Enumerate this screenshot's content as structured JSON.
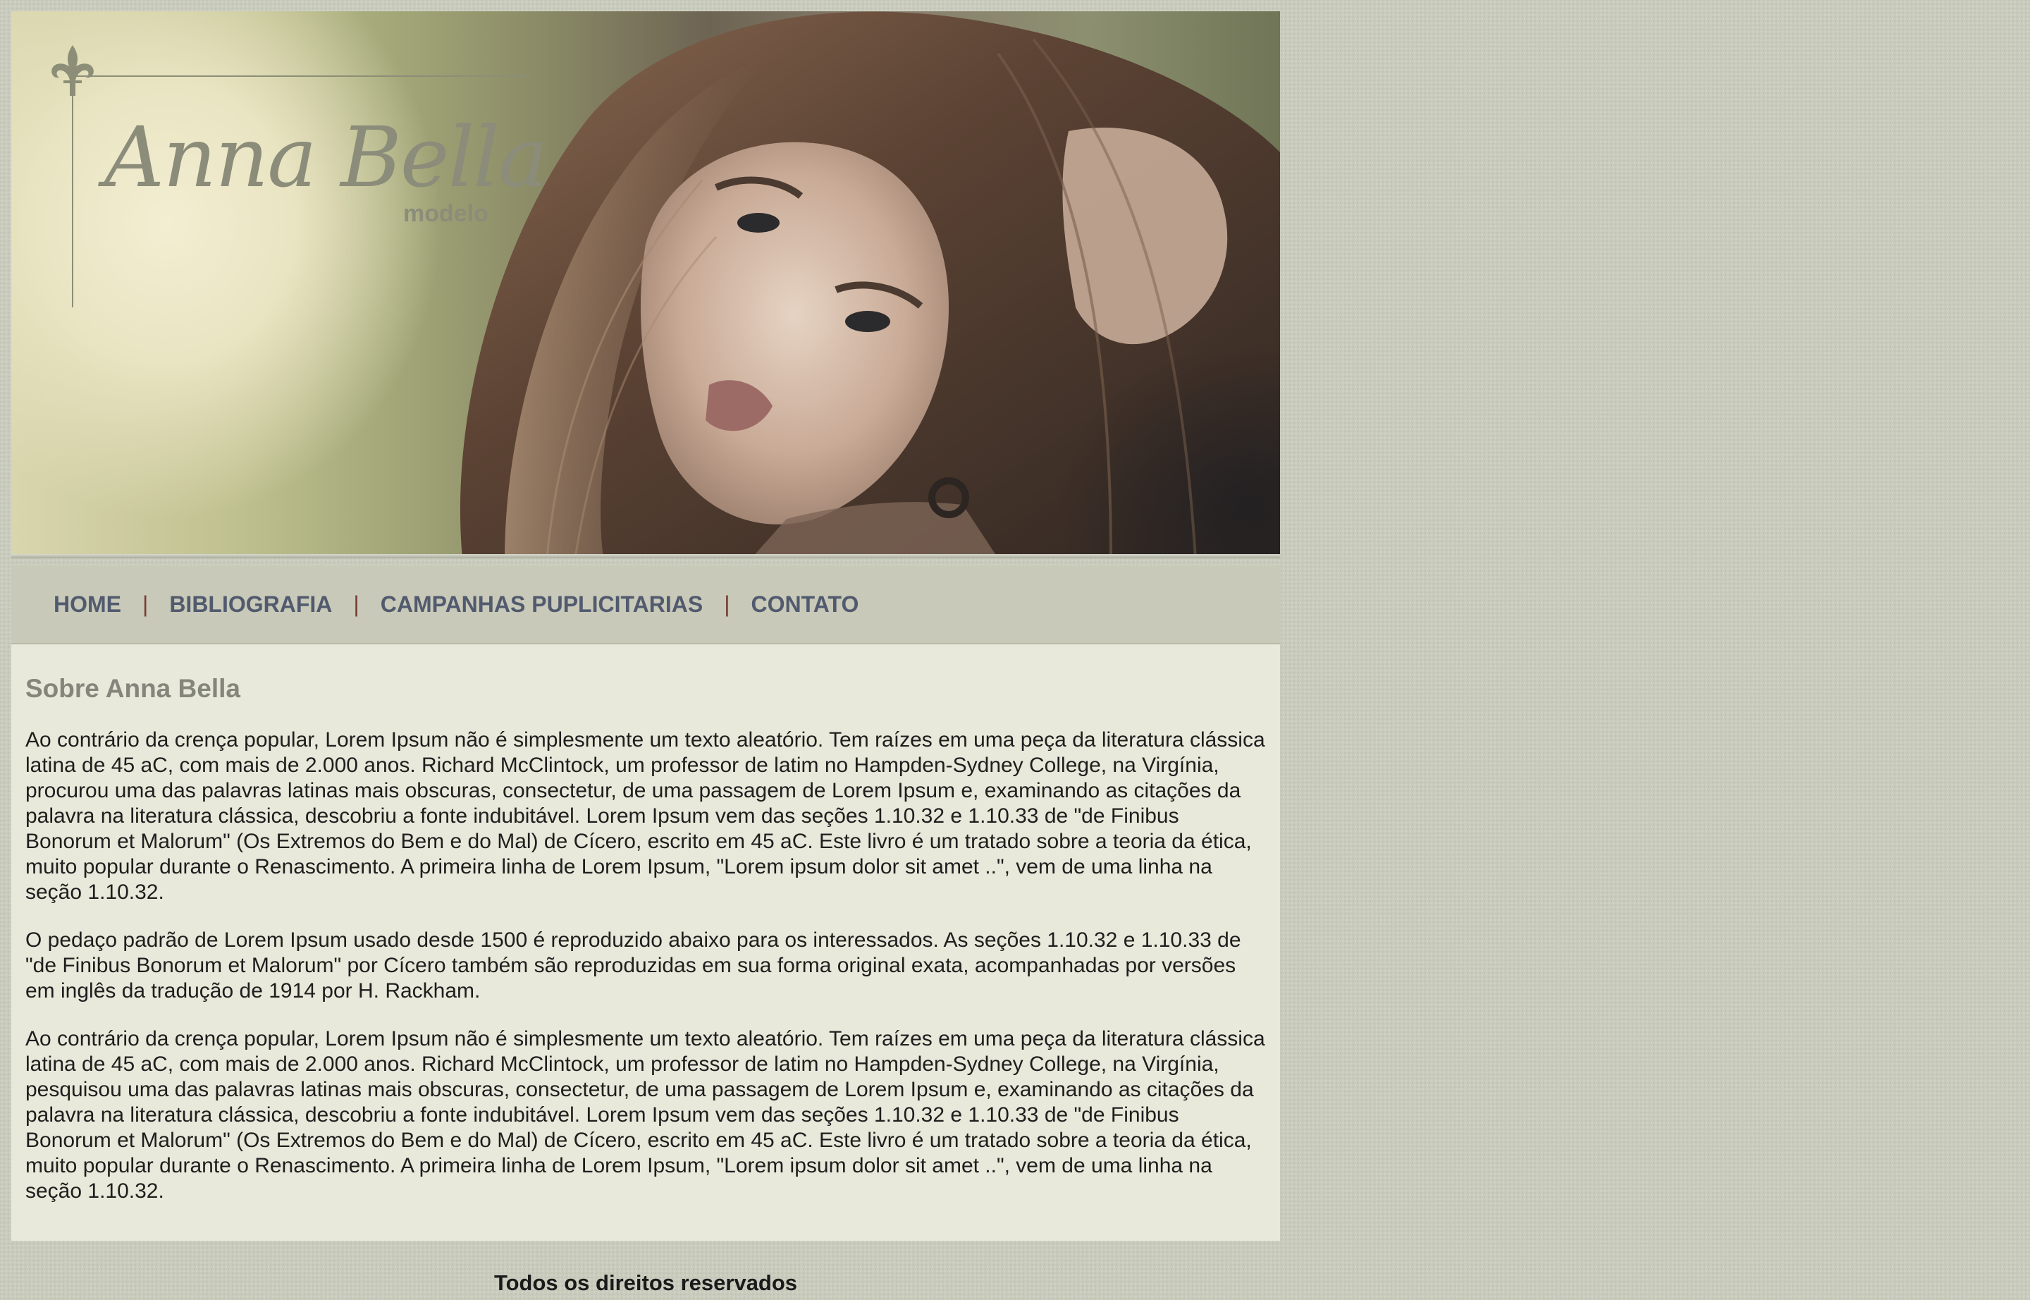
{
  "header": {
    "logo_name": "Anna Bella",
    "logo_subtitle": "modelo",
    "banner_image": "portrait-photo"
  },
  "nav": {
    "items": [
      {
        "label": "HOME"
      },
      {
        "label": "BIBLIOGRAFIA"
      },
      {
        "label": "CAMPANHAS PUPLICITARIAS"
      },
      {
        "label": "CONTATO"
      }
    ],
    "separator": "|"
  },
  "main": {
    "title": "Sobre Anna Bella",
    "paragraphs": [
      "Ao contrário da crença popular, Lorem Ipsum não é simplesmente um texto aleatório. Tem raízes em uma peça da literatura clássica latina de 45 aC, com mais de 2.000 anos. Richard McClintock, um professor de latim no Hampden-Sydney College, na Virgínia, procurou uma das palavras latinas mais obscuras, consectetur, de uma passagem de Lorem Ipsum e, examinando as citações da palavra na literatura clássica, descobriu a fonte indubitável. Lorem Ipsum vem das seções 1.10.32 e 1.10.33 de \"de Finibus Bonorum et Malorum\" (Os Extremos do Bem e do Mal) de Cícero, escrito em 45 aC. Este livro é um tratado sobre a teoria da ética, muito popular durante o Renascimento. A primeira linha de Lorem Ipsum, \"Lorem ipsum dolor sit amet ..\", vem de uma linha na seção 1.10.32.",
      "O pedaço padrão de Lorem Ipsum usado desde 1500 é reproduzido abaixo para os interessados. As seções 1.10.32 e 1.10.33 de \"de Finibus Bonorum et Malorum\" por Cícero também são reproduzidas em sua forma original exata, acompanhadas por versões em inglês da tradução de 1914 por H. Rackham.",
      "Ao contrário da crença popular, Lorem Ipsum não é simplesmente um texto aleatório. Tem raízes em uma peça da literatura clássica latina de 45 aC, com mais de 2.000 anos. Richard McClintock, um professor de latim no Hampden-Sydney College, na Virgínia, pesquisou uma das palavras latinas mais obscuras, consectetur, de uma passagem de Lorem Ipsum e, examinando as citações da palavra na literatura clássica, descobriu a fonte indubitável. Lorem Ipsum vem das seções 1.10.32 e 1.10.33 de \"de Finibus Bonorum et Malorum\" (Os Extremos do Bem e do Mal) de Cícero, escrito em 45 aC. Este livro é um tratado sobre a teoria da ética, muito popular durante o Renascimento. A primeira linha de Lorem Ipsum, \"Lorem ipsum dolor sit amet ..\", vem de uma linha na seção 1.10.32."
    ]
  },
  "footer": {
    "text": "Todos os direitos reservados"
  },
  "colors": {
    "page_bg": "#c9ccbd",
    "nav_bg": "#c8c9b8",
    "nav_link": "#515a6e",
    "nav_separator": "#7a3a32",
    "content_bg": "#e8e9da",
    "heading": "#84857b",
    "logo": "#8b8c79"
  }
}
